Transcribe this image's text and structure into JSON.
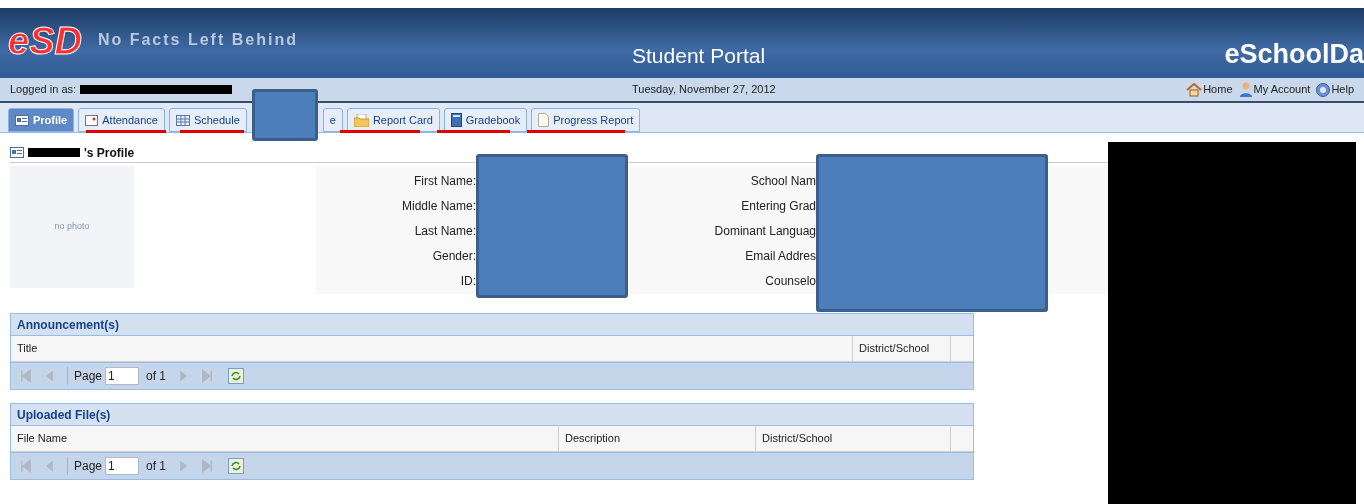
{
  "header": {
    "logo": "eSD",
    "tagline": "No Facts Left Behind",
    "title": "Student Portal",
    "brand": "eSchoolDa"
  },
  "info_bar": {
    "logged_in_label": "Logged in as:",
    "date": "Tuesday, November 27, 2012",
    "links": [
      {
        "label": "Home",
        "kind": "home"
      },
      {
        "label": "My Account",
        "kind": "account"
      },
      {
        "label": "Help",
        "kind": "help"
      }
    ]
  },
  "tabs": [
    {
      "label": "Profile",
      "kind": "profile",
      "selected": true
    },
    {
      "label": "Attendance",
      "kind": "attendance",
      "selected": false
    },
    {
      "label": "Schedule",
      "kind": "schedule",
      "selected": false
    },
    {
      "label": "e",
      "kind": "hidden",
      "selected": false
    },
    {
      "label": "Report Card",
      "kind": "folder",
      "selected": false
    },
    {
      "label": "Gradebook",
      "kind": "book",
      "selected": false
    },
    {
      "label": "Progress Report",
      "kind": "page",
      "selected": false
    }
  ],
  "profile": {
    "title": "'s Profile",
    "photo_text": "no photo",
    "left_fields": [
      "First Name:",
      "Middle Name:",
      "Last Name:",
      "Gender:",
      "ID:"
    ],
    "right_fields": [
      "School Nam",
      "Entering Grad",
      "Dominant Languag",
      "Email Addres",
      "Counselo"
    ]
  },
  "panels": [
    {
      "title": "Announcement(s)",
      "columns": [
        "Title",
        "District/School"
      ],
      "pager": {
        "page_label": "Page",
        "page": "1",
        "of": "of 1"
      }
    },
    {
      "title": "Uploaded File(s)",
      "columns": [
        "File Name",
        "Description",
        "District/School"
      ],
      "pager": {
        "page_label": "Page",
        "page": "1",
        "of": "of 1"
      }
    }
  ]
}
